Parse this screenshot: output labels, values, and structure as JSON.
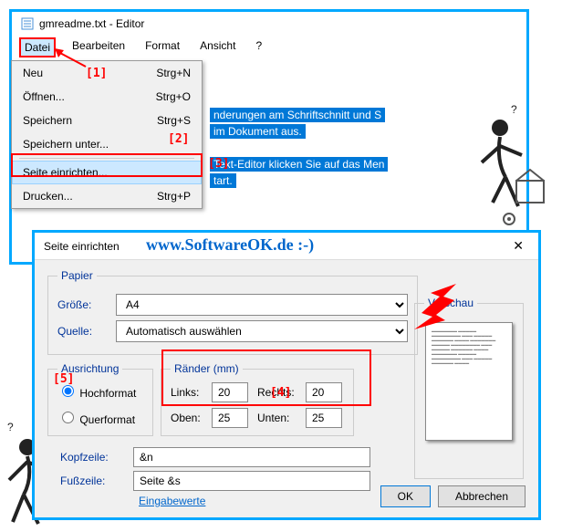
{
  "editor": {
    "title": "gmreadme.txt - Editor",
    "menus": {
      "datei": "Datei",
      "bearbeiten": "Bearbeiten",
      "format": "Format",
      "ansicht": "Ansicht",
      "help": "?"
    }
  },
  "dropdown": {
    "neu": "Neu",
    "neu_key": "Strg+N",
    "open": "Öffnen...",
    "open_key": "Strg+O",
    "save": "Speichern",
    "save_key": "Strg+S",
    "saveas": "Speichern unter...",
    "page": "Seite einrichten...",
    "print": "Drucken...",
    "print_key": "Strg+P"
  },
  "bg_text": {
    "line1": "nderungen am Schriftschnitt und S",
    "line2": "im Dokument aus.",
    "line3": "Text-Editor klicken Sie auf das Men",
    "line4": "tart."
  },
  "brand": "www.SoftwareOK.de :-)",
  "annotations": {
    "a1": "[1]",
    "a2": "[2]",
    "a3": "[3]",
    "a4": "[4]",
    "a5": "[5]"
  },
  "dialog": {
    "title": "Seite einrichten",
    "papier_legend": "Papier",
    "groesse_label": "Größe:",
    "groesse_value": "A4",
    "quelle_label": "Quelle:",
    "quelle_value": "Automatisch auswählen",
    "ausrichtung_legend": "Ausrichtung",
    "hochformat": "Hochformat",
    "querformat": "Querformat",
    "raender_legend": "Ränder (mm)",
    "links": "Links:",
    "links_v": "20",
    "rechts": "Rechts:",
    "rechts_v": "20",
    "oben": "Oben:",
    "oben_v": "25",
    "unten": "Unten:",
    "unten_v": "25",
    "vorschau_legend": "Vorschau",
    "kopfzeile": "Kopfzeile:",
    "kopfzeile_v": "&n",
    "fusszeile": "Fußzeile:",
    "fusszeile_v": "Seite &s",
    "eingabewerte": "Eingabewerte",
    "ok": "OK",
    "cancel": "Abbrechen"
  }
}
